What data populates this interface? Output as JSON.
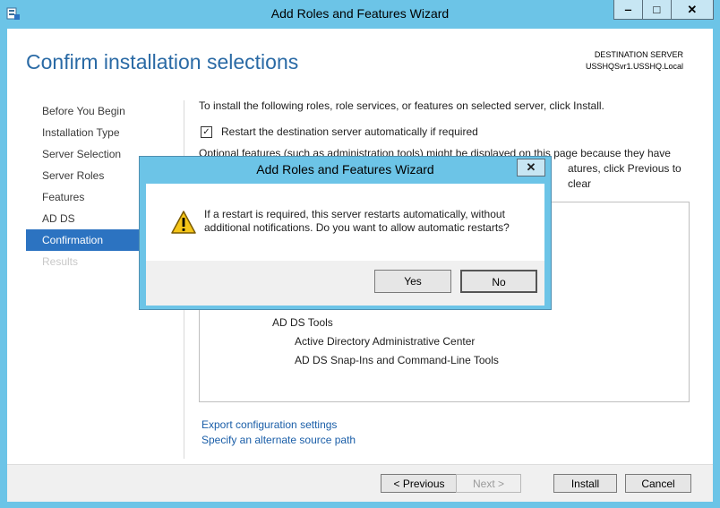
{
  "window": {
    "title": "Add Roles and Features Wizard",
    "controls": {
      "minimize": "‒",
      "maximize": "□",
      "close": "✕"
    }
  },
  "header": {
    "page_title": "Confirm installation selections",
    "destination_label": "DESTINATION SERVER",
    "destination_value": "USSHQSvr1.USSHQ.Local"
  },
  "nav": {
    "items": [
      {
        "label": "Before You Begin",
        "state": "normal"
      },
      {
        "label": "Installation Type",
        "state": "normal"
      },
      {
        "label": "Server Selection",
        "state": "normal"
      },
      {
        "label": "Server Roles",
        "state": "normal"
      },
      {
        "label": "Features",
        "state": "normal"
      },
      {
        "label": "AD DS",
        "state": "normal"
      },
      {
        "label": "Confirmation",
        "state": "active"
      },
      {
        "label": "Results",
        "state": "disabled"
      }
    ]
  },
  "content": {
    "intro": "To install the following roles, role services, or features on selected server, click Install.",
    "restart_checkbox": {
      "label": "Restart the destination server automatically if required",
      "checked": true
    },
    "optional_text_line1": "Optional features (such as administration tools) might be displayed on this page because they have",
    "optional_text_line2_tail": "atures, click Previous to clear",
    "features": {
      "ad_ds_tools": "AD DS Tools",
      "ad_admin_center": "Active Directory Administrative Center",
      "snapins": "AD DS Snap-Ins and Command-Line Tools"
    },
    "links": {
      "export": "Export configuration settings",
      "alternate_source": "Specify an alternate source path"
    }
  },
  "footer": {
    "previous": "< Previous",
    "next": "Next >",
    "install": "Install",
    "cancel": "Cancel"
  },
  "dialog": {
    "title": "Add Roles and Features Wizard",
    "close": "✕",
    "message": "If a restart is required, this server restarts automatically, without additional notifications. Do you want to allow automatic restarts?",
    "yes": "Yes",
    "no": "No",
    "icon": "warning-icon"
  },
  "colors": {
    "accent_title": "#2a6aa5",
    "nav_active": "#2c73c1",
    "frame": "#6cc4e7",
    "link": "#1a5ea8"
  }
}
